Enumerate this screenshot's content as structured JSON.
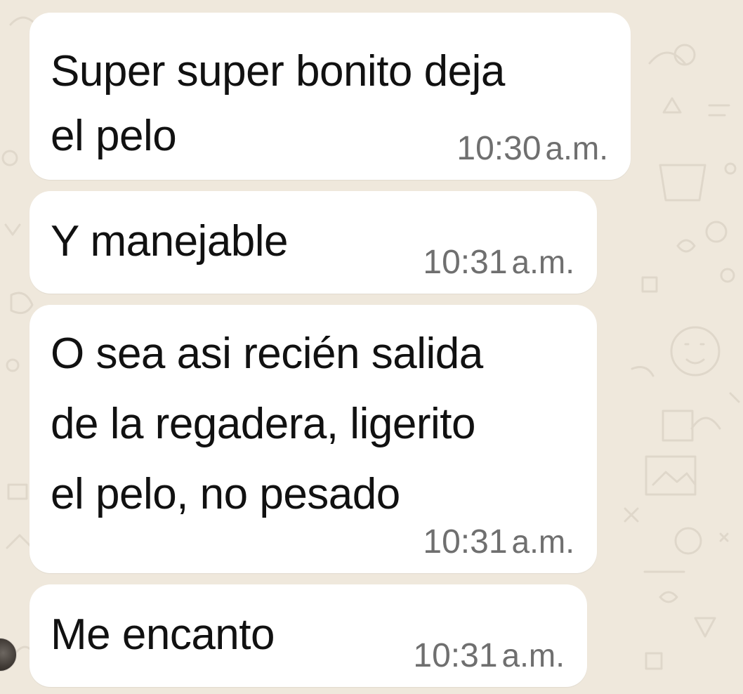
{
  "chat": {
    "messages": [
      {
        "text": "Super super bonito deja\nel pelo",
        "time": "10:30",
        "suffix": "a.m."
      },
      {
        "text": "Y manejable",
        "time": "10:31",
        "suffix": "a.m."
      },
      {
        "text": "O sea asi recién salida\nde la regadera, ligerito\nel pelo, no pesado",
        "time": "10:31",
        "suffix": "a.m."
      },
      {
        "text": "Me encanto",
        "time": "10:31",
        "suffix": "a.m."
      }
    ]
  },
  "colors": {
    "background": "#efe8dc",
    "bubble": "#ffffff",
    "text": "#111111",
    "timestamp": "#6f6f6f"
  },
  "icons": {
    "background_pattern": "doodle-pattern-icon",
    "avatar": "contact-avatar-icon"
  }
}
